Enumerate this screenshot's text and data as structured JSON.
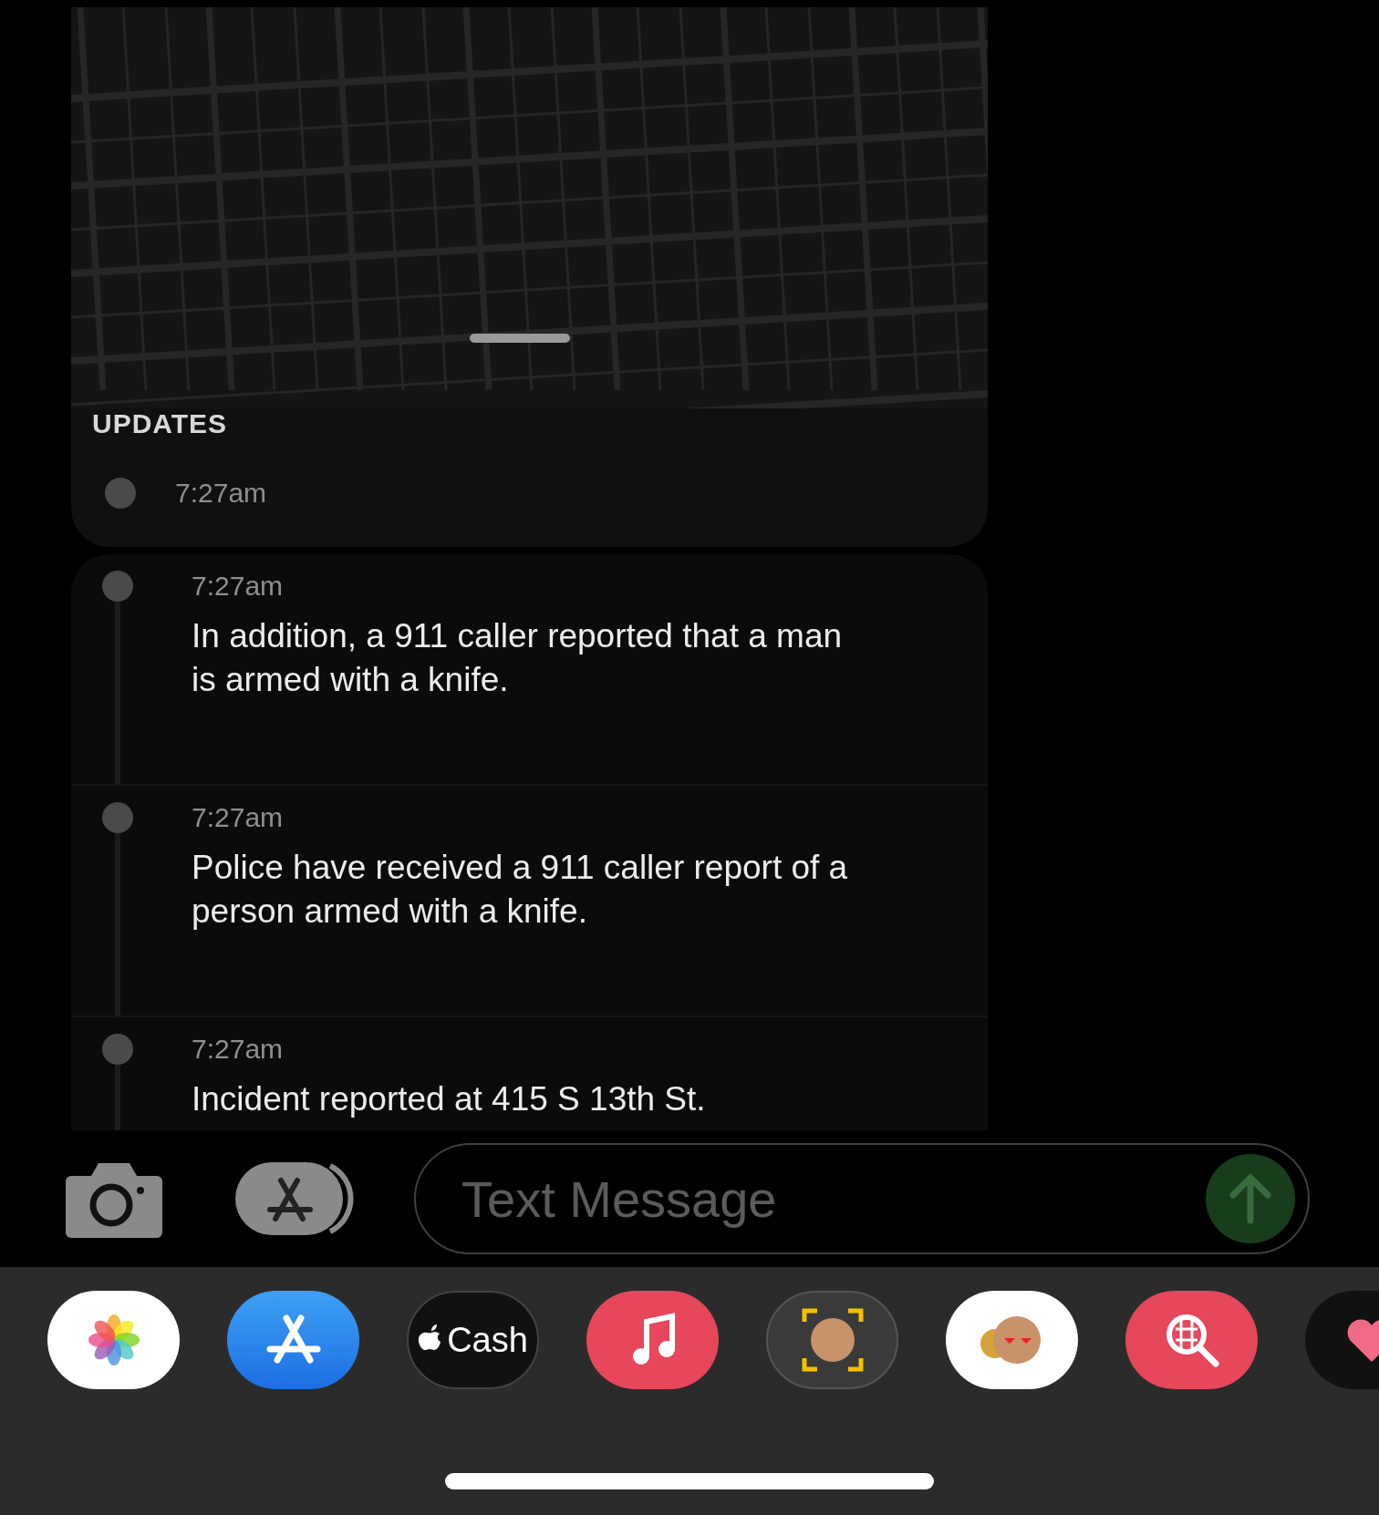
{
  "updates_header": "UPDATES",
  "hidden_update": {
    "time": "7:27am"
  },
  "updates": [
    {
      "time": "7:27am",
      "text": "In addition, a 911 caller reported that a man is armed with a knife."
    },
    {
      "time": "7:27am",
      "text": "Police have received a 911 caller report of a person armed with a knife."
    },
    {
      "time": "7:27am",
      "text": "Incident reported at 415 S 13th St."
    }
  ],
  "composer": {
    "placeholder": "Text Message"
  },
  "app_drawer": [
    {
      "kind": "photos"
    },
    {
      "kind": "app-store"
    },
    {
      "kind": "cash",
      "label": "Cash"
    },
    {
      "kind": "music"
    },
    {
      "kind": "memoji"
    },
    {
      "kind": "stickers"
    },
    {
      "kind": "search"
    },
    {
      "kind": "heart"
    }
  ]
}
